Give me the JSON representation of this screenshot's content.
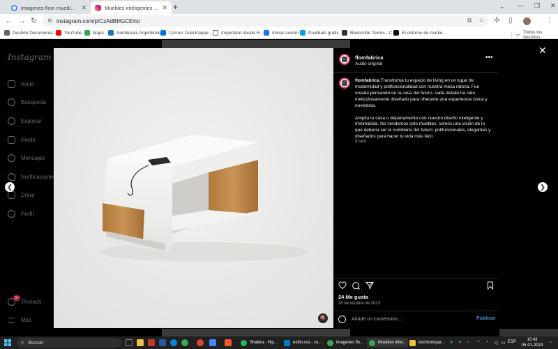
{
  "browser": {
    "tabs": [
      {
        "title": "imagenes flom muebles - Busc",
        "active": false
      },
      {
        "title": "Muebles inteligentes |@flomfa",
        "active": true
      }
    ],
    "url": "instagram.com/p/CzAdBHGCE4x/",
    "bookmarks": [
      "Gestión Documenta...",
      "YouTube",
      "Maps",
      "Aerolineas Argentinas",
      "Correo: Ariel Kappe...",
      "Importado desde Fi...",
      "Iniciar sesión",
      "Pruébalo gratis",
      "Reescribir Textos - C...",
      "El entorno de marke..."
    ],
    "all_bookmarks_label": "Todos los favoritos"
  },
  "instagram": {
    "logo": "Instagram",
    "nav": [
      "Inicio",
      "Búsqueda",
      "Explorar",
      "Reels",
      "Mensajes",
      "Notificaciones",
      "Crear",
      "Perfil"
    ],
    "threads_label": "Threads",
    "threads_badge": "9+",
    "more_label": "Más"
  },
  "post": {
    "username": "flomfabrica",
    "audio": "Audio original",
    "caption_p1": "Transforma tu espacio de living en un lugar de modernidad y polifuncionalidad con nuestra mesa ratona. Fue creada pensando en la casa del futuro, cada detalle ha sido meticulosamente diseñado para ofrecerte una experiencia única y novedosa.",
    "caption_p2": "Amplía tu casa o departamento con nuestro diseño inteligente y minimalista. No vendemos solo muebles, somos una visión de lo que debería ser el mobiliario del futuro: polifuncionales, elegantes y diseñados para hacer tu vida más fácil.",
    "caption_time": "9 sem",
    "likes": "24 Me gusta",
    "date": "30 de octubre de 2023",
    "comment_placeholder": "Añade un comentario...",
    "publish_label": "Publicar"
  },
  "taskbar": {
    "search_label": "Buscar",
    "apps": [
      "Shakira - Hip...",
      "estilo.css - co...",
      "imagenes flo...",
      "Muebles intel...",
      "escritoriopar..."
    ],
    "lang": "ESP",
    "time": "10:43",
    "date": "05-01-2024"
  },
  "colors": {
    "instagram_link": "#4c8fd1",
    "avatar_ring": "#d62976",
    "threads_badge": "#b3222a"
  }
}
